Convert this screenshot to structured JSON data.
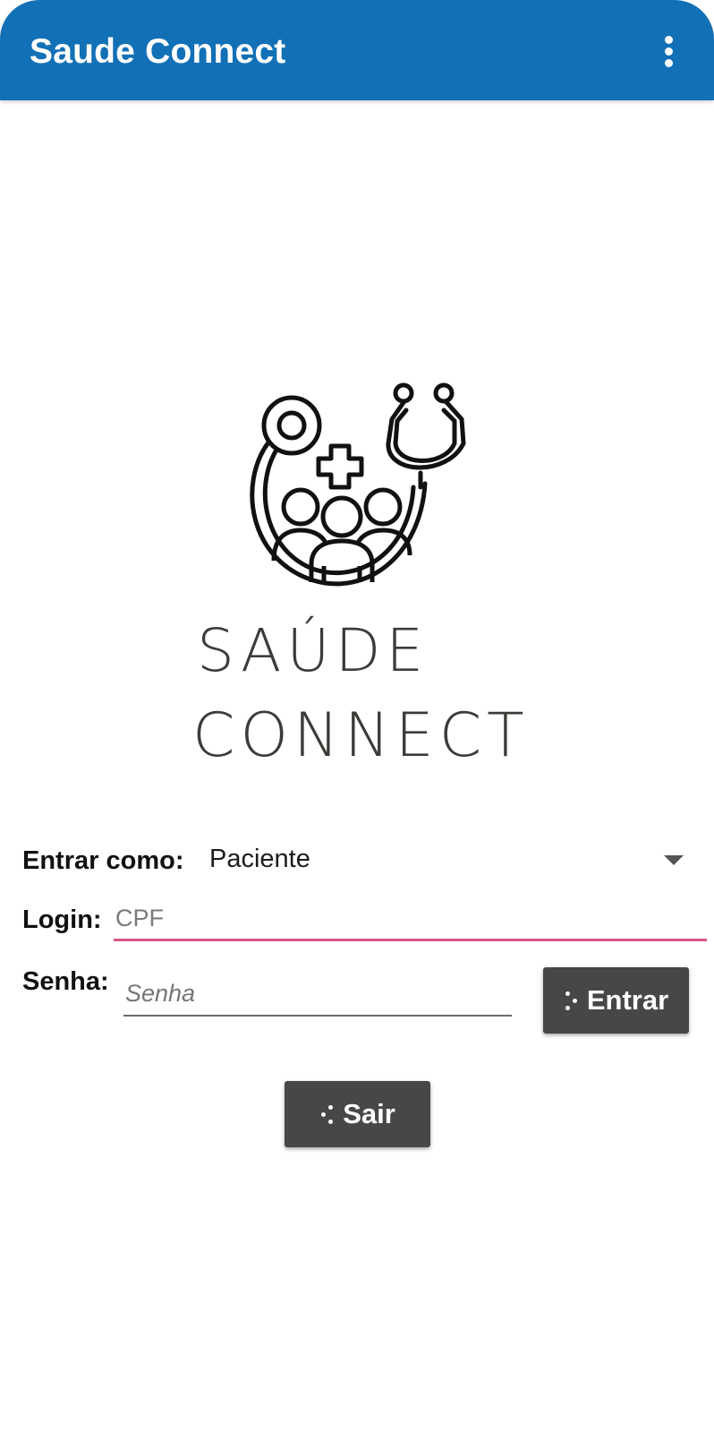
{
  "colors": {
    "app_bar": "#1270b6",
    "button_bg": "#474747",
    "login_underline": "#d9578a"
  },
  "app_bar": {
    "title": "Saude Connect",
    "overflow_icon": "more-vert-icon"
  },
  "logo": {
    "line1": "SAÚDE",
    "line2": "CONNECT",
    "icons": [
      "stethoscope-icon",
      "medical-cross-icon",
      "people-group-icon"
    ]
  },
  "form": {
    "role_label": "Entrar como:",
    "role_value": "Paciente",
    "login_label": "Login:",
    "login_placeholder": "CPF",
    "password_label": "Senha:",
    "password_placeholder": "Senha"
  },
  "buttons": {
    "entrar": "Entrar",
    "sair": "Sair",
    "icon": "dots-loader-icon"
  }
}
